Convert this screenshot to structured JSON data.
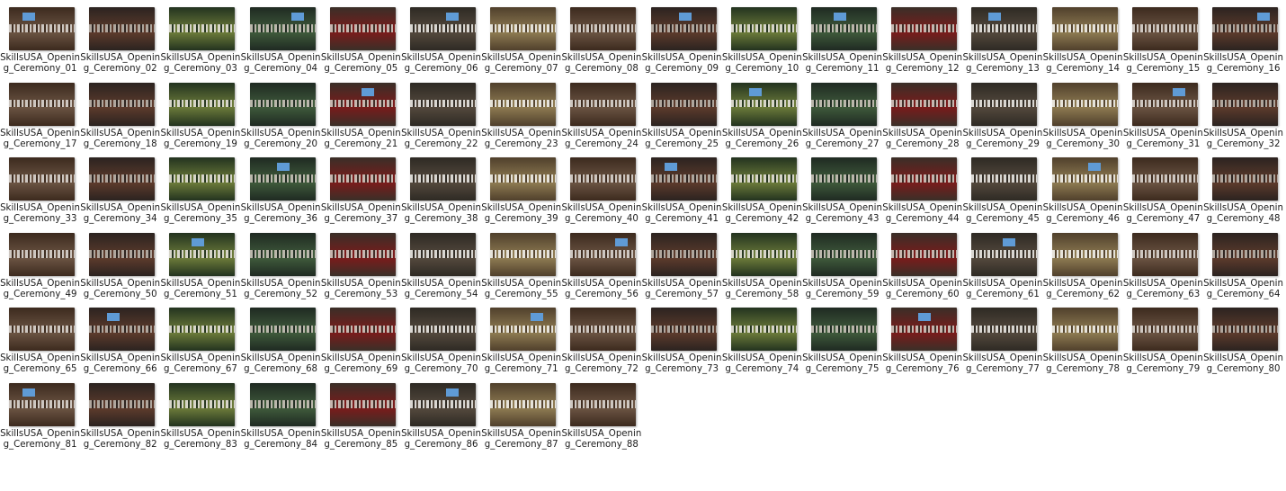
{
  "files": [
    {
      "name": "SkillsUSA_Opening_Ceremony_01"
    },
    {
      "name": "SkillsUSA_Opening_Ceremony_02"
    },
    {
      "name": "SkillsUSA_Opening_Ceremony_03"
    },
    {
      "name": "SkillsUSA_Opening_Ceremony_04"
    },
    {
      "name": "SkillsUSA_Opening_Ceremony_05"
    },
    {
      "name": "SkillsUSA_Opening_Ceremony_06"
    },
    {
      "name": "SkillsUSA_Opening_Ceremony_07"
    },
    {
      "name": "SkillsUSA_Opening_Ceremony_08"
    },
    {
      "name": "SkillsUSA_Opening_Ceremony_09"
    },
    {
      "name": "SkillsUSA_Opening_Ceremony_10"
    },
    {
      "name": "SkillsUSA_Opening_Ceremony_11"
    },
    {
      "name": "SkillsUSA_Opening_Ceremony_12"
    },
    {
      "name": "SkillsUSA_Opening_Ceremony_13"
    },
    {
      "name": "SkillsUSA_Opening_Ceremony_14"
    },
    {
      "name": "SkillsUSA_Opening_Ceremony_15"
    },
    {
      "name": "SkillsUSA_Opening_Ceremony_16"
    },
    {
      "name": "SkillsUSA_Opening_Ceremony_17"
    },
    {
      "name": "SkillsUSA_Opening_Ceremony_18"
    },
    {
      "name": "SkillsUSA_Opening_Ceremony_19"
    },
    {
      "name": "SkillsUSA_Opening_Ceremony_20"
    },
    {
      "name": "SkillsUSA_Opening_Ceremony_21"
    },
    {
      "name": "SkillsUSA_Opening_Ceremony_22"
    },
    {
      "name": "SkillsUSA_Opening_Ceremony_23"
    },
    {
      "name": "SkillsUSA_Opening_Ceremony_24"
    },
    {
      "name": "SkillsUSA_Opening_Ceremony_25"
    },
    {
      "name": "SkillsUSA_Opening_Ceremony_26"
    },
    {
      "name": "SkillsUSA_Opening_Ceremony_27"
    },
    {
      "name": "SkillsUSA_Opening_Ceremony_28"
    },
    {
      "name": "SkillsUSA_Opening_Ceremony_29"
    },
    {
      "name": "SkillsUSA_Opening_Ceremony_30"
    },
    {
      "name": "SkillsUSA_Opening_Ceremony_31"
    },
    {
      "name": "SkillsUSA_Opening_Ceremony_32"
    },
    {
      "name": "SkillsUSA_Opening_Ceremony_33"
    },
    {
      "name": "SkillsUSA_Opening_Ceremony_34"
    },
    {
      "name": "SkillsUSA_Opening_Ceremony_35"
    },
    {
      "name": "SkillsUSA_Opening_Ceremony_36"
    },
    {
      "name": "SkillsUSA_Opening_Ceremony_37"
    },
    {
      "name": "SkillsUSA_Opening_Ceremony_38"
    },
    {
      "name": "SkillsUSA_Opening_Ceremony_39"
    },
    {
      "name": "SkillsUSA_Opening_Ceremony_40"
    },
    {
      "name": "SkillsUSA_Opening_Ceremony_41"
    },
    {
      "name": "SkillsUSA_Opening_Ceremony_42"
    },
    {
      "name": "SkillsUSA_Opening_Ceremony_43"
    },
    {
      "name": "SkillsUSA_Opening_Ceremony_44"
    },
    {
      "name": "SkillsUSA_Opening_Ceremony_45"
    },
    {
      "name": "SkillsUSA_Opening_Ceremony_46"
    },
    {
      "name": "SkillsUSA_Opening_Ceremony_47"
    },
    {
      "name": "SkillsUSA_Opening_Ceremony_48"
    },
    {
      "name": "SkillsUSA_Opening_Ceremony_49"
    },
    {
      "name": "SkillsUSA_Opening_Ceremony_50"
    },
    {
      "name": "SkillsUSA_Opening_Ceremony_51"
    },
    {
      "name": "SkillsUSA_Opening_Ceremony_52"
    },
    {
      "name": "SkillsUSA_Opening_Ceremony_53"
    },
    {
      "name": "SkillsUSA_Opening_Ceremony_54"
    },
    {
      "name": "SkillsUSA_Opening_Ceremony_55"
    },
    {
      "name": "SkillsUSA_Opening_Ceremony_56"
    },
    {
      "name": "SkillsUSA_Opening_Ceremony_57"
    },
    {
      "name": "SkillsUSA_Opening_Ceremony_58"
    },
    {
      "name": "SkillsUSA_Opening_Ceremony_59"
    },
    {
      "name": "SkillsUSA_Opening_Ceremony_60"
    },
    {
      "name": "SkillsUSA_Opening_Ceremony_61"
    },
    {
      "name": "SkillsUSA_Opening_Ceremony_62"
    },
    {
      "name": "SkillsUSA_Opening_Ceremony_63"
    },
    {
      "name": "SkillsUSA_Opening_Ceremony_64"
    },
    {
      "name": "SkillsUSA_Opening_Ceremony_65"
    },
    {
      "name": "SkillsUSA_Opening_Ceremony_66"
    },
    {
      "name": "SkillsUSA_Opening_Ceremony_67"
    },
    {
      "name": "SkillsUSA_Opening_Ceremony_68"
    },
    {
      "name": "SkillsUSA_Opening_Ceremony_69"
    },
    {
      "name": "SkillsUSA_Opening_Ceremony_70"
    },
    {
      "name": "SkillsUSA_Opening_Ceremony_71"
    },
    {
      "name": "SkillsUSA_Opening_Ceremony_72"
    },
    {
      "name": "SkillsUSA_Opening_Ceremony_73"
    },
    {
      "name": "SkillsUSA_Opening_Ceremony_74"
    },
    {
      "name": "SkillsUSA_Opening_Ceremony_75"
    },
    {
      "name": "SkillsUSA_Opening_Ceremony_76"
    },
    {
      "name": "SkillsUSA_Opening_Ceremony_77"
    },
    {
      "name": "SkillsUSA_Opening_Ceremony_78"
    },
    {
      "name": "SkillsUSA_Opening_Ceremony_79"
    },
    {
      "name": "SkillsUSA_Opening_Ceremony_80"
    },
    {
      "name": "SkillsUSA_Opening_Ceremony_81"
    },
    {
      "name": "SkillsUSA_Opening_Ceremony_82"
    },
    {
      "name": "SkillsUSA_Opening_Ceremony_83"
    },
    {
      "name": "SkillsUSA_Opening_Ceremony_84"
    },
    {
      "name": "SkillsUSA_Opening_Ceremony_85"
    },
    {
      "name": "SkillsUSA_Opening_Ceremony_86"
    },
    {
      "name": "SkillsUSA_Opening_Ceremony_87"
    },
    {
      "name": "SkillsUSA_Opening_Ceremony_88"
    }
  ]
}
